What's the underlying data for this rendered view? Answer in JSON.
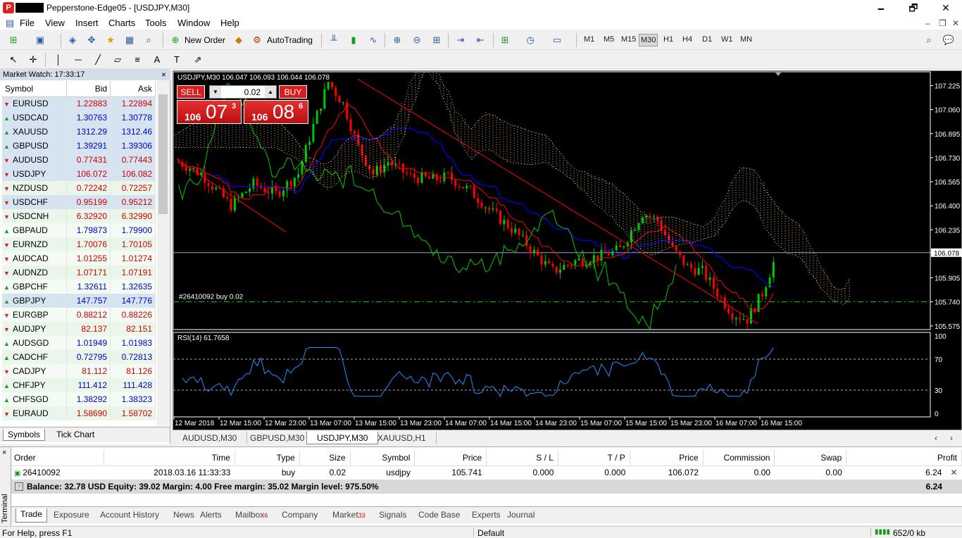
{
  "window": {
    "title": "Pepperstone-Edge05 - [USDJPY,M30]",
    "minimize": "🗕",
    "restore": "🗗",
    "close": "✕"
  },
  "menu": [
    "File",
    "View",
    "Insert",
    "Charts",
    "Tools",
    "Window",
    "Help"
  ],
  "toolbar": {
    "new_order": "New Order",
    "autotrading": "AutoTrading",
    "timeframes": [
      "M1",
      "M5",
      "M15",
      "M30",
      "H1",
      "H4",
      "D1",
      "W1",
      "MN"
    ],
    "active_timeframe": "M30"
  },
  "market_watch": {
    "header": "Market Watch: 17:33:17",
    "close": "×",
    "columns": [
      "Symbol",
      "Bid",
      "Ask"
    ],
    "rows": [
      {
        "symbol": "EURUSD",
        "bid": "1.22883",
        "ask": "1.22894",
        "dir": "down",
        "hl": true
      },
      {
        "symbol": "USDCAD",
        "bid": "1.30763",
        "ask": "1.30778",
        "dir": "up",
        "hl": true
      },
      {
        "symbol": "XAUUSD",
        "bid": "1312.29",
        "ask": "1312.46",
        "dir": "up",
        "hl": true
      },
      {
        "symbol": "GBPUSD",
        "bid": "1.39291",
        "ask": "1.39306",
        "dir": "up",
        "hl": true
      },
      {
        "symbol": "AUDUSD",
        "bid": "0.77431",
        "ask": "0.77443",
        "dir": "down",
        "hl": true
      },
      {
        "symbol": "USDJPY",
        "bid": "106.072",
        "ask": "106.082",
        "dir": "down",
        "hl": true
      },
      {
        "symbol": "NZDUSD",
        "bid": "0.72242",
        "ask": "0.72257",
        "dir": "down",
        "hl": false
      },
      {
        "symbol": "USDCHF",
        "bid": "0.95199",
        "ask": "0.95212",
        "dir": "down",
        "hl": true
      },
      {
        "symbol": "USDCNH",
        "bid": "6.32920",
        "ask": "6.32990",
        "dir": "down",
        "hl": false
      },
      {
        "symbol": "GBPAUD",
        "bid": "1.79873",
        "ask": "1.79900",
        "dir": "up",
        "hl": false
      },
      {
        "symbol": "EURNZD",
        "bid": "1.70076",
        "ask": "1.70105",
        "dir": "down",
        "hl": false
      },
      {
        "symbol": "AUDCAD",
        "bid": "1.01255",
        "ask": "1.01274",
        "dir": "down",
        "hl": false
      },
      {
        "symbol": "AUDNZD",
        "bid": "1.07171",
        "ask": "1.07191",
        "dir": "down",
        "hl": false
      },
      {
        "symbol": "GBPCHF",
        "bid": "1.32611",
        "ask": "1.32635",
        "dir": "up",
        "hl": false
      },
      {
        "symbol": "GBPJPY",
        "bid": "147.757",
        "ask": "147.776",
        "dir": "up",
        "hl": true
      },
      {
        "symbol": "EURGBP",
        "bid": "0.88212",
        "ask": "0.88226",
        "dir": "down",
        "hl": false
      },
      {
        "symbol": "AUDJPY",
        "bid": "82.137",
        "ask": "82.151",
        "dir": "down",
        "hl": false
      },
      {
        "symbol": "AUDSGD",
        "bid": "1.01949",
        "ask": "1.01983",
        "dir": "up",
        "hl": false
      },
      {
        "symbol": "CADCHF",
        "bid": "0.72795",
        "ask": "0.72813",
        "dir": "up",
        "hl": false
      },
      {
        "symbol": "CADJPY",
        "bid": "81.112",
        "ask": "81.126",
        "dir": "down",
        "hl": false
      },
      {
        "symbol": "CHFJPY",
        "bid": "111.412",
        "ask": "111.428",
        "dir": "up",
        "hl": false
      },
      {
        "symbol": "CHFSGD",
        "bid": "1.38292",
        "ask": "1.38323",
        "dir": "up",
        "hl": false
      },
      {
        "symbol": "EURAUD",
        "bid": "1.58690",
        "ask": "1.58702",
        "dir": "down",
        "hl": false
      }
    ],
    "tabs": [
      "Symbols",
      "Tick Chart"
    ]
  },
  "chart": {
    "header": "USDJPY,M30  106.047 106.093 106.044 106.078",
    "one_click": {
      "sell": "SELL",
      "buy": "BUY",
      "lot": "0.02",
      "sell_small": "106",
      "sell_big": "07",
      "sell_sup": "3",
      "buy_small": "106",
      "buy_big": "08",
      "buy_sup": "6"
    },
    "order_label": "#26410092 buy 0.02",
    "rsi_label": "RSI(14) 61.7658",
    "price_levels": [
      "107.225",
      "107.060",
      "106.895",
      "106.730",
      "106.565",
      "106.400",
      "106.235",
      "106.078",
      "105.905",
      "105.740",
      "105.575"
    ],
    "current_price": "106.078",
    "rsi_levels": [
      "100",
      "70",
      "30",
      "0"
    ],
    "time_labels": [
      "12 Mar 2018",
      "12 Mar 15:00",
      "12 Mar 23:00",
      "13 Mar 07:00",
      "13 Mar 15:00",
      "13 Mar 23:00",
      "14 Mar 07:00",
      "14 Mar 15:00",
      "14 Mar 23:00",
      "15 Mar 07:00",
      "15 Mar 15:00",
      "15 Mar 23:00",
      "16 Mar 07:00",
      "16 Mar 15:00"
    ],
    "colors": {
      "bull": "#00c800",
      "bear": "#ff0000",
      "kijun": "#0000ff",
      "tenkan": "#ff0000",
      "chikou": "#00c800",
      "cloud": "#ffd0a0",
      "rsi": "#1e90ff",
      "trend": "#ff0000"
    }
  },
  "chart_tabs": [
    "AUDUSD,M30",
    "GBPUSD,M30",
    "USDJPY,M30",
    "XAUUSD,H1"
  ],
  "active_chart_tab": "USDJPY,M30",
  "terminal": {
    "side_label": "Terminal",
    "close": "×",
    "columns": [
      "Order",
      "Time",
      "Type",
      "Size",
      "Symbol",
      "Price",
      "S / L",
      "T / P",
      "Price",
      "Commission",
      "Swap",
      "Profit"
    ],
    "order": {
      "order": "26410092",
      "time": "2018.03.16 11:33:33",
      "type": "buy",
      "size": "0.02",
      "symbol": "usdjpy",
      "price": "105.741",
      "sl": "0.000",
      "tp": "0.000",
      "cur_price": "106.072",
      "commission": "0.00",
      "swap": "0.00",
      "profit": "6.24"
    },
    "balance_line": "Balance: 32.78 USD  Equity: 39.02  Margin: 4.00  Free margin: 35.02  Margin level: 975.50%",
    "total_profit": "6.24",
    "tabs": [
      {
        "label": "Trade",
        "badge": ""
      },
      {
        "label": "Exposure",
        "badge": ""
      },
      {
        "label": "Account History",
        "badge": ""
      },
      {
        "label": "News",
        "badge": ""
      },
      {
        "label": "Alerts",
        "badge": ""
      },
      {
        "label": "Mailbox",
        "badge": "6"
      },
      {
        "label": "Company",
        "badge": ""
      },
      {
        "label": "Market",
        "badge": "33"
      },
      {
        "label": "Signals",
        "badge": ""
      },
      {
        "label": "Code Base",
        "badge": ""
      },
      {
        "label": "Experts",
        "badge": ""
      },
      {
        "label": "Journal",
        "badge": ""
      }
    ]
  },
  "status": {
    "help": "For Help, press F1",
    "profile": "Default",
    "traffic": "652/0 kb"
  }
}
